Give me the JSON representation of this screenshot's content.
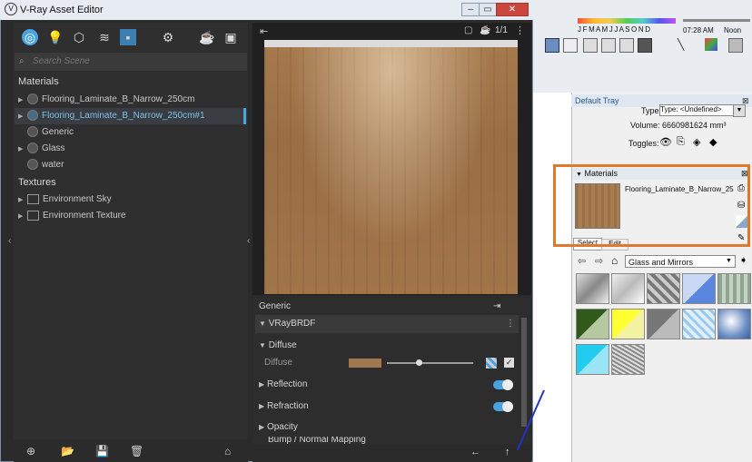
{
  "vray": {
    "title": "V-Ray Asset Editor",
    "search_placeholder": "Search Scene",
    "materials_label": "Materials",
    "materials": [
      "Flooring_Laminate_B_Narrow_250cm",
      "Flooring_Laminate_B_Narrow_250cm#1",
      "Generic",
      "Glass",
      "water"
    ],
    "textures_label": "Textures",
    "textures": [
      "Environment Sky",
      "Environment Texture"
    ],
    "preview_counter": "1/1",
    "props": {
      "header": "Generic",
      "brdf": "VRayBRDF",
      "diffuse_section": "Diffuse",
      "diffuse_label": "Diffuse",
      "reflection": "Reflection",
      "refraction": "Refraction",
      "opacity": "Opacity",
      "bump": "Bump / Normal Mapping"
    },
    "diffuse_color": "#a07850",
    "accent": "#4aa3df"
  },
  "sketchup": {
    "time_left": "07:28 AM",
    "time_mid": "Noon",
    "shadow_letters": "J F M A M J J A S O N D",
    "tray_title": "Default Tray",
    "type_label": "Type:",
    "type_value": "Type: <Undefined>",
    "volume_label": "Volume:",
    "volume_value": "6660981624 mm³",
    "toggles_label": "Toggles:",
    "materials_header": "Materials",
    "material_name": "Flooring_Laminate_B_Narrow_25",
    "tab_select": "Select",
    "tab_edit": "Edit",
    "library": "Glass and Mirrors"
  }
}
